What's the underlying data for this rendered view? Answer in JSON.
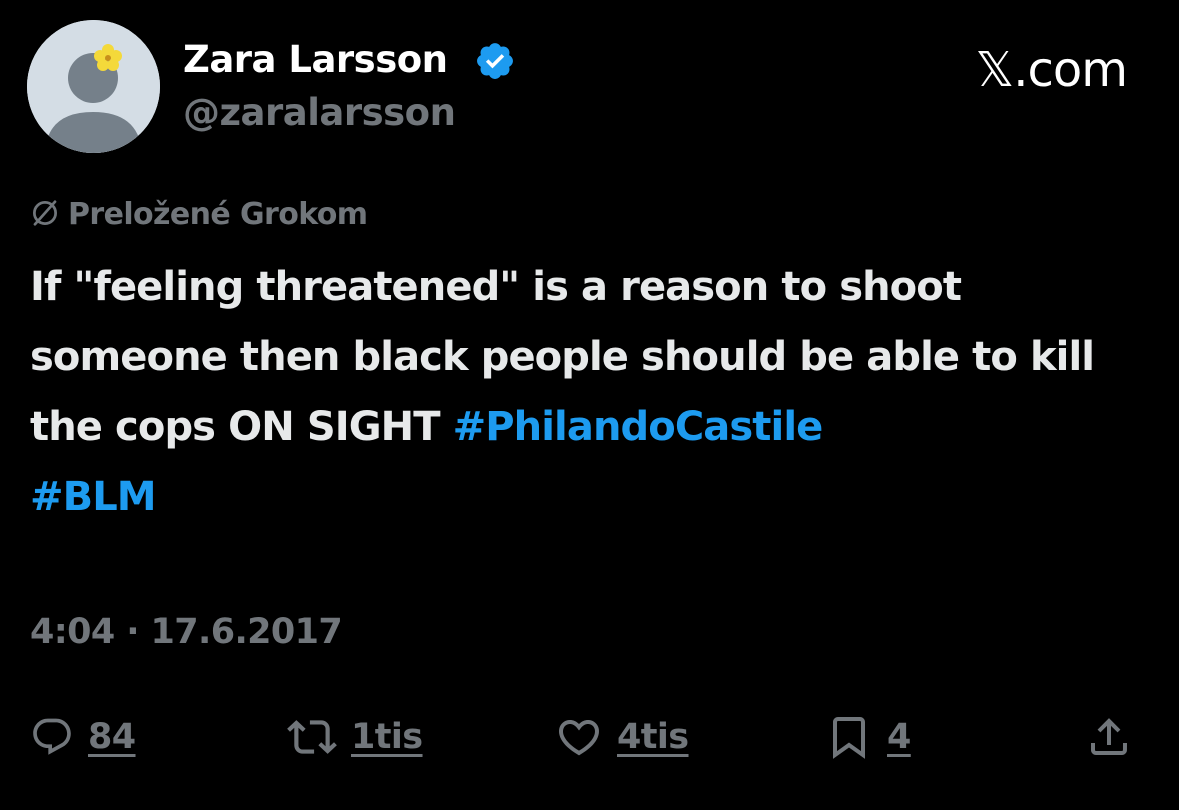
{
  "author": {
    "name": "Zara Larsson",
    "handle": "@zaralarsson",
    "verified": true
  },
  "brand": "𝕏.com",
  "translation_note": "Preložené Grokom",
  "tweet": {
    "text_main": "If \"feeling threatened\" is a reason to shoot someone then black people should be able to kill the cops ON SIGHT ",
    "hashtag_1": "#PhilandoCastile",
    "hashtag_2": "#BLM"
  },
  "timestamp": "4:04 · 17.6.2017",
  "actions": {
    "reply_count": "84",
    "retweet_count": "1tis",
    "like_count": "4tis",
    "bookmark_count": "4"
  },
  "colors": {
    "background": "#000000",
    "text": "#e7e9ea",
    "muted": "#71767b",
    "link": "#1d9bf0",
    "verified": "#1d9bf0"
  },
  "icons": [
    "verified-badge-icon",
    "translate-globe-icon",
    "reply-icon",
    "retweet-icon",
    "like-icon",
    "bookmark-icon",
    "share-icon"
  ]
}
